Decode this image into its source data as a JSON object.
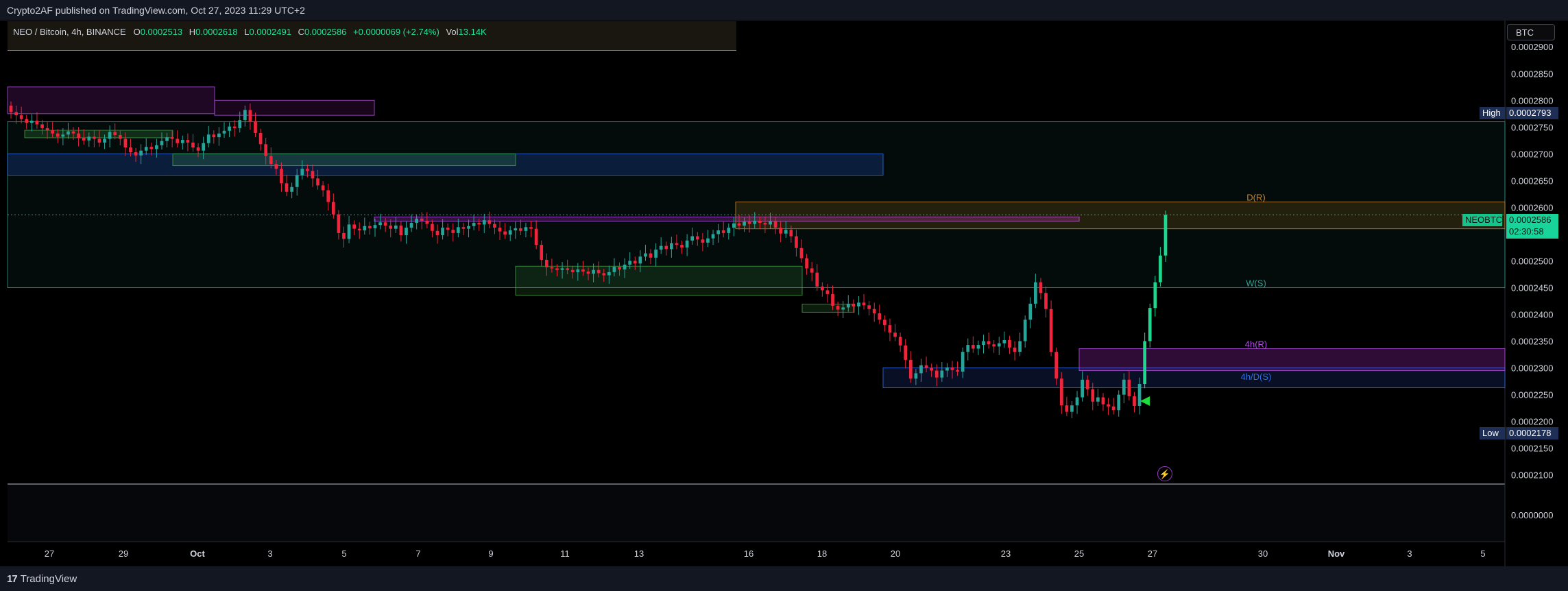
{
  "publisher_line": "Crypto2AF published on TradingView.com, Oct 27, 2023 11:29 UTC+2",
  "legend": {
    "pair": "NEO / Bitcoin, 4h, BINANCE",
    "open_label": "O",
    "open": "0.0002513",
    "high_label": "H",
    "high": "0.0002618",
    "low_label": "L",
    "low": "0.0002491",
    "close_label": "C",
    "close": "0.0002586",
    "change": "+0.0000069 (+2.74%)",
    "vol_label": "Vol",
    "vol": "13.14K"
  },
  "currency_button": "BTC",
  "footer_logo": "TradingView",
  "footer_logo_mark": "17",
  "price_tags": {
    "high_label": "High",
    "high_value": "0.0002793",
    "low_label": "Low",
    "low_value": "0.0002178",
    "symbol": "NEOBTC",
    "last_price": "0.0002586",
    "countdown": "02:30:58"
  },
  "colors": {
    "up": "#26a69a",
    "up_bright": "#1fd68f",
    "down": "#f0243a",
    "zone_purple": "#9c27b0",
    "zone_blue": "#2962ff",
    "zone_green": "#43a047",
    "zone_orange": "#ffa726"
  },
  "icons": {
    "flash": "lightning-icon"
  },
  "chart_data": {
    "type": "candlestick",
    "symbol": "NEOBTC",
    "interval": "4h",
    "exchange": "BINANCE",
    "y_ticks": [
      "0.0002900",
      "0.0002850",
      "0.0002800",
      "0.0002750",
      "0.0002700",
      "0.0002650",
      "0.0002600",
      "0.0002550",
      "0.0002500",
      "0.0002450",
      "0.0002400",
      "0.0002350",
      "0.0002300",
      "0.0002250",
      "0.0002200",
      "0.0002150",
      "0.0002100"
    ],
    "volume_axis_tick": "0.0000000",
    "x_ticks": [
      "27",
      "29",
      "Oct",
      "3",
      "5",
      "7",
      "9",
      "11",
      "13",
      "16",
      "18",
      "20",
      "23",
      "25",
      "27",
      "30",
      "Nov",
      "3",
      "5"
    ],
    "ylim": [
      0.0002083,
      0.0002949
    ],
    "annotations": [
      {
        "text": "D(R)",
        "price": 0.000261,
        "color": "#c8882c"
      },
      {
        "text": "W(S)",
        "price": 0.000245,
        "color": "#2b9e8c"
      },
      {
        "text": "4h(R)",
        "price": 0.0002336,
        "color": "#b04fe0"
      },
      {
        "text": "4h/D(S)",
        "price": 0.0002275,
        "color": "#2f6fe8"
      }
    ],
    "series": [
      {
        "name": "NEOBTC",
        "values": [
          0.0002778,
          0.0002772,
          0.0002765,
          0.0002758,
          0.0002762,
          0.0002755,
          0.0002748,
          0.0002744,
          0.0002738,
          0.0002732,
          0.0002736,
          0.0002742,
          0.0002738,
          0.000273,
          0.0002725,
          0.0002732,
          0.0002728,
          0.0002721,
          0.0002728,
          0.0002741,
          0.0002735,
          0.0002728,
          0.0002712,
          0.0002703,
          0.0002697,
          0.0002706,
          0.0002713,
          0.0002709,
          0.0002716,
          0.0002724,
          0.0002731,
          0.0002728,
          0.000272,
          0.0002726,
          0.0002721,
          0.0002712,
          0.0002706,
          0.000272,
          0.0002736,
          0.0002731,
          0.0002738,
          0.0002743,
          0.0002751,
          0.0002748,
          0.0002763,
          0.0002782,
          0.0002761,
          0.0002739,
          0.0002718,
          0.0002696,
          0.0002681,
          0.0002672,
          0.0002645,
          0.0002629,
          0.0002638,
          0.000266,
          0.0002672,
          0.0002668,
          0.0002654,
          0.0002641,
          0.0002632,
          0.000261,
          0.0002587,
          0.0002552,
          0.0002541,
          0.0002568,
          0.000256,
          0.0002557,
          0.0002565,
          0.0002561,
          0.0002567,
          0.0002572,
          0.0002566,
          0.000256,
          0.0002566,
          0.0002548,
          0.0002562,
          0.0002571,
          0.0002579,
          0.0002575,
          0.0002569,
          0.0002556,
          0.0002548,
          0.0002562,
          0.0002558,
          0.0002552,
          0.0002563,
          0.000256,
          0.0002565,
          0.0002571,
          0.0002568,
          0.0002576,
          0.0002569,
          0.0002562,
          0.0002555,
          0.0002549,
          0.0002557,
          0.0002561,
          0.0002556,
          0.0002563,
          0.000256,
          0.000253,
          0.0002502,
          0.0002488,
          0.0002486,
          0.0002483,
          0.0002486,
          0.0002483,
          0.0002479,
          0.0002484,
          0.000248,
          0.0002476,
          0.0002483,
          0.0002477,
          0.0002473,
          0.0002479,
          0.0002489,
          0.0002484,
          0.0002493,
          0.00025,
          0.0002495,
          0.0002508,
          0.0002514,
          0.0002506,
          0.0002521,
          0.0002528,
          0.0002522,
          0.0002533,
          0.000253,
          0.0002525,
          0.0002538,
          0.0002546,
          0.000254,
          0.0002534,
          0.0002542,
          0.000255,
          0.0002557,
          0.0002552,
          0.0002562,
          0.000257,
          0.0002566,
          0.0002573,
          0.0002569,
          0.0002575,
          0.0002571,
          0.0002568,
          0.0002574,
          0.0002562,
          0.0002551,
          0.0002558,
          0.0002546,
          0.0002524,
          0.0002505,
          0.0002486,
          0.0002478,
          0.0002452,
          0.0002445,
          0.0002438,
          0.0002416,
          0.0002409,
          0.0002413,
          0.000242,
          0.0002415,
          0.0002422,
          0.0002417,
          0.000241,
          0.0002402,
          0.000239,
          0.000238,
          0.0002366,
          0.0002358,
          0.0002342,
          0.0002315,
          0.000228,
          0.000229,
          0.0002305,
          0.00023,
          0.0002295,
          0.0002282,
          0.0002295,
          0.0002301,
          0.0002296,
          0.0002293,
          0.000233,
          0.0002343,
          0.0002336,
          0.0002343,
          0.000235,
          0.0002344,
          0.000234,
          0.0002346,
          0.0002352,
          0.0002338,
          0.000233,
          0.000235,
          0.000239,
          0.000242,
          0.000246,
          0.000244,
          0.000241,
          0.000233,
          0.000228,
          0.000223,
          0.0002218,
          0.000223,
          0.0002245,
          0.0002278,
          0.000226,
          0.0002237,
          0.0002245,
          0.0002232,
          0.0002228,
          0.0002221,
          0.000225,
          0.0002278,
          0.0002247,
          0.0002229,
          0.000227,
          0.000235,
          0.0002412,
          0.000246,
          0.000251,
          0.0002586
        ]
      }
    ]
  }
}
